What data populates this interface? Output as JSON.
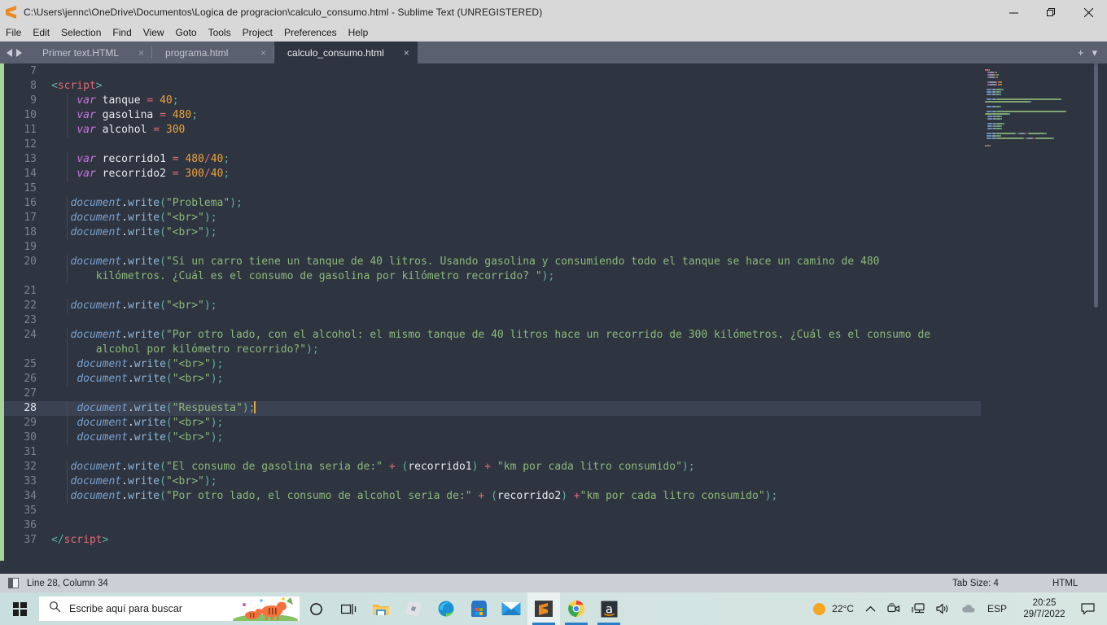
{
  "window": {
    "title": "C:\\Users\\jennc\\OneDrive\\Documentos\\Logica de progracion\\calculo_consumo.html - Sublime Text (UNREGISTERED)",
    "app_logo": "sublime-text-logo",
    "controls": {
      "minimize": "minimize-icon",
      "maximize": "restore-icon",
      "close": "close-icon"
    }
  },
  "menubar": {
    "items": [
      {
        "label": "File"
      },
      {
        "label": "Edit"
      },
      {
        "label": "Selection"
      },
      {
        "label": "Find"
      },
      {
        "label": "View"
      },
      {
        "label": "Goto"
      },
      {
        "label": "Tools"
      },
      {
        "label": "Project"
      },
      {
        "label": "Preferences"
      },
      {
        "label": "Help"
      }
    ]
  },
  "tabs": {
    "nav_prev": "prev-tab-arrow",
    "nav_next": "next-tab-arrow",
    "close_glyph": "×",
    "add_glyph": "+",
    "menu_glyph": "▾",
    "items": [
      {
        "label": "Primer text.HTML",
        "active": false
      },
      {
        "label": "programa.html",
        "active": false
      },
      {
        "label": "calculo_consumo.html",
        "active": true
      }
    ]
  },
  "editor": {
    "first_line": 7,
    "active_line": 28,
    "lines": [
      {
        "n": 7,
        "tokens": []
      },
      {
        "n": 8,
        "tokens": [
          {
            "t": "punct",
            "v": "<"
          },
          {
            "t": "tag",
            "v": "script"
          },
          {
            "t": "punct",
            "v": ">"
          }
        ]
      },
      {
        "n": 9,
        "tokens": [
          {
            "t": "plain",
            "v": "    "
          },
          {
            "t": "kw",
            "v": "var"
          },
          {
            "t": "var",
            "v": " tanque "
          },
          {
            "t": "op",
            "v": "="
          },
          {
            "t": "plain",
            "v": " "
          },
          {
            "t": "num",
            "v": "40"
          },
          {
            "t": "punct",
            "v": ";"
          }
        ]
      },
      {
        "n": 10,
        "tokens": [
          {
            "t": "plain",
            "v": "    "
          },
          {
            "t": "kw",
            "v": "var"
          },
          {
            "t": "var",
            "v": " gasolina "
          },
          {
            "t": "op",
            "v": "="
          },
          {
            "t": "plain",
            "v": " "
          },
          {
            "t": "num",
            "v": "480"
          },
          {
            "t": "punct",
            "v": ";"
          }
        ]
      },
      {
        "n": 11,
        "tokens": [
          {
            "t": "plain",
            "v": "    "
          },
          {
            "t": "kw",
            "v": "var"
          },
          {
            "t": "var",
            "v": " alcohol "
          },
          {
            "t": "op",
            "v": "="
          },
          {
            "t": "plain",
            "v": " "
          },
          {
            "t": "num",
            "v": "300"
          }
        ]
      },
      {
        "n": 12,
        "tokens": []
      },
      {
        "n": 13,
        "tokens": [
          {
            "t": "plain",
            "v": "    "
          },
          {
            "t": "kw",
            "v": "var"
          },
          {
            "t": "var",
            "v": " recorrido1 "
          },
          {
            "t": "op",
            "v": "="
          },
          {
            "t": "plain",
            "v": " "
          },
          {
            "t": "num",
            "v": "480"
          },
          {
            "t": "op",
            "v": "/"
          },
          {
            "t": "num",
            "v": "40"
          },
          {
            "t": "punct",
            "v": ";"
          }
        ]
      },
      {
        "n": 14,
        "tokens": [
          {
            "t": "plain",
            "v": "    "
          },
          {
            "t": "kw",
            "v": "var"
          },
          {
            "t": "var",
            "v": " recorrido2 "
          },
          {
            "t": "op",
            "v": "="
          },
          {
            "t": "plain",
            "v": " "
          },
          {
            "t": "num",
            "v": "300"
          },
          {
            "t": "op",
            "v": "/"
          },
          {
            "t": "num",
            "v": "40"
          },
          {
            "t": "punct",
            "v": ";"
          }
        ]
      },
      {
        "n": 15,
        "tokens": []
      },
      {
        "n": 16,
        "tokens": [
          {
            "t": "plain",
            "v": "   "
          },
          {
            "t": "obj",
            "v": "document"
          },
          {
            "t": "plain",
            "v": "."
          },
          {
            "t": "fn",
            "v": "write"
          },
          {
            "t": "paren",
            "v": "("
          },
          {
            "t": "str",
            "v": "\"Problema\""
          },
          {
            "t": "paren",
            "v": ")"
          },
          {
            "t": "punct",
            "v": ";"
          }
        ]
      },
      {
        "n": 17,
        "tokens": [
          {
            "t": "plain",
            "v": "   "
          },
          {
            "t": "obj",
            "v": "document"
          },
          {
            "t": "plain",
            "v": "."
          },
          {
            "t": "fn",
            "v": "write"
          },
          {
            "t": "paren",
            "v": "("
          },
          {
            "t": "str",
            "v": "\"<br>\""
          },
          {
            "t": "paren",
            "v": ")"
          },
          {
            "t": "punct",
            "v": ";"
          }
        ]
      },
      {
        "n": 18,
        "tokens": [
          {
            "t": "plain",
            "v": "   "
          },
          {
            "t": "obj",
            "v": "document"
          },
          {
            "t": "plain",
            "v": "."
          },
          {
            "t": "fn",
            "v": "write"
          },
          {
            "t": "paren",
            "v": "("
          },
          {
            "t": "str",
            "v": "\"<br>\""
          },
          {
            "t": "paren",
            "v": ")"
          },
          {
            "t": "punct",
            "v": ";"
          }
        ]
      },
      {
        "n": 19,
        "tokens": []
      },
      {
        "n": 20,
        "tokens": [
          {
            "t": "plain",
            "v": "   "
          },
          {
            "t": "obj",
            "v": "document"
          },
          {
            "t": "plain",
            "v": "."
          },
          {
            "t": "fn",
            "v": "write"
          },
          {
            "t": "paren",
            "v": "("
          },
          {
            "t": "str",
            "v": "\"Si un carro tiene un tanque de 40 litros. Usando gasolina y consumiendo todo el tanque se hace un camino de 480"
          }
        ]
      },
      {
        "n": "",
        "wrap": true,
        "tokens": [
          {
            "t": "str",
            "v": "       kilómetros. ¿Cuál es el consumo de gasolina por kilómetro recorrido? \""
          },
          {
            "t": "paren",
            "v": ")"
          },
          {
            "t": "punct",
            "v": ";"
          }
        ]
      },
      {
        "n": 21,
        "tokens": []
      },
      {
        "n": 22,
        "tokens": [
          {
            "t": "plain",
            "v": "   "
          },
          {
            "t": "obj",
            "v": "document"
          },
          {
            "t": "plain",
            "v": "."
          },
          {
            "t": "fn",
            "v": "write"
          },
          {
            "t": "paren",
            "v": "("
          },
          {
            "t": "str",
            "v": "\"<br>\""
          },
          {
            "t": "paren",
            "v": ")"
          },
          {
            "t": "punct",
            "v": ";"
          }
        ]
      },
      {
        "n": 23,
        "tokens": []
      },
      {
        "n": 24,
        "tokens": [
          {
            "t": "plain",
            "v": "   "
          },
          {
            "t": "obj",
            "v": "document"
          },
          {
            "t": "plain",
            "v": "."
          },
          {
            "t": "fn",
            "v": "write"
          },
          {
            "t": "paren",
            "v": "("
          },
          {
            "t": "str",
            "v": "\"Por otro lado, con el alcohol: el mismo tanque de 40 litros hace un recorrido de 300 kilómetros. ¿Cuál es el consumo de"
          }
        ]
      },
      {
        "n": "",
        "wrap": true,
        "tokens": [
          {
            "t": "str",
            "v": "       alcohol por kilómetro recorrido?\""
          },
          {
            "t": "paren",
            "v": ")"
          },
          {
            "t": "punct",
            "v": ";"
          }
        ]
      },
      {
        "n": 25,
        "tokens": [
          {
            "t": "plain",
            "v": "    "
          },
          {
            "t": "obj",
            "v": "document"
          },
          {
            "t": "plain",
            "v": "."
          },
          {
            "t": "fn",
            "v": "write"
          },
          {
            "t": "paren",
            "v": "("
          },
          {
            "t": "str",
            "v": "\"<br>\""
          },
          {
            "t": "paren",
            "v": ")"
          },
          {
            "t": "punct",
            "v": ";"
          }
        ]
      },
      {
        "n": 26,
        "tokens": [
          {
            "t": "plain",
            "v": "    "
          },
          {
            "t": "obj",
            "v": "document"
          },
          {
            "t": "plain",
            "v": "."
          },
          {
            "t": "fn",
            "v": "write"
          },
          {
            "t": "paren",
            "v": "("
          },
          {
            "t": "str",
            "v": "\"<br>\""
          },
          {
            "t": "paren",
            "v": ")"
          },
          {
            "t": "punct",
            "v": ";"
          }
        ]
      },
      {
        "n": 27,
        "tokens": []
      },
      {
        "n": 28,
        "active": true,
        "cursor": true,
        "tokens": [
          {
            "t": "plain",
            "v": "    "
          },
          {
            "t": "obj",
            "v": "document"
          },
          {
            "t": "plain",
            "v": "."
          },
          {
            "t": "fn",
            "v": "write"
          },
          {
            "t": "paren",
            "v": "("
          },
          {
            "t": "str",
            "v": "\"Respuesta\""
          },
          {
            "t": "paren",
            "v": ")"
          },
          {
            "t": "punct",
            "v": ";"
          }
        ]
      },
      {
        "n": 29,
        "tokens": [
          {
            "t": "plain",
            "v": "    "
          },
          {
            "t": "obj",
            "v": "document"
          },
          {
            "t": "plain",
            "v": "."
          },
          {
            "t": "fn",
            "v": "write"
          },
          {
            "t": "paren",
            "v": "("
          },
          {
            "t": "str",
            "v": "\"<br>\""
          },
          {
            "t": "paren",
            "v": ")"
          },
          {
            "t": "punct",
            "v": ";"
          }
        ]
      },
      {
        "n": 30,
        "tokens": [
          {
            "t": "plain",
            "v": "    "
          },
          {
            "t": "obj",
            "v": "document"
          },
          {
            "t": "plain",
            "v": "."
          },
          {
            "t": "fn",
            "v": "write"
          },
          {
            "t": "paren",
            "v": "("
          },
          {
            "t": "str",
            "v": "\"<br>\""
          },
          {
            "t": "paren",
            "v": ")"
          },
          {
            "t": "punct",
            "v": ";"
          }
        ]
      },
      {
        "n": 31,
        "tokens": []
      },
      {
        "n": 32,
        "tokens": [
          {
            "t": "plain",
            "v": "   "
          },
          {
            "t": "obj",
            "v": "document"
          },
          {
            "t": "plain",
            "v": "."
          },
          {
            "t": "fn",
            "v": "write"
          },
          {
            "t": "paren",
            "v": "("
          },
          {
            "t": "str",
            "v": "\"El consumo de gasolina seria de:\""
          },
          {
            "t": "plain",
            "v": " "
          },
          {
            "t": "op",
            "v": "+"
          },
          {
            "t": "plain",
            "v": " "
          },
          {
            "t": "paren",
            "v": "("
          },
          {
            "t": "var",
            "v": "recorrido1"
          },
          {
            "t": "paren",
            "v": ")"
          },
          {
            "t": "plain",
            "v": " "
          },
          {
            "t": "op",
            "v": "+"
          },
          {
            "t": "plain",
            "v": " "
          },
          {
            "t": "str",
            "v": "\"km por cada litro consumido\""
          },
          {
            "t": "paren",
            "v": ")"
          },
          {
            "t": "punct",
            "v": ";"
          }
        ]
      },
      {
        "n": 33,
        "tokens": [
          {
            "t": "plain",
            "v": "   "
          },
          {
            "t": "obj",
            "v": "document"
          },
          {
            "t": "plain",
            "v": "."
          },
          {
            "t": "fn",
            "v": "write"
          },
          {
            "t": "paren",
            "v": "("
          },
          {
            "t": "str",
            "v": "\"<br>\""
          },
          {
            "t": "paren",
            "v": ")"
          },
          {
            "t": "punct",
            "v": ";"
          }
        ]
      },
      {
        "n": 34,
        "tokens": [
          {
            "t": "plain",
            "v": "   "
          },
          {
            "t": "obj",
            "v": "document"
          },
          {
            "t": "plain",
            "v": "."
          },
          {
            "t": "fn",
            "v": "write"
          },
          {
            "t": "paren",
            "v": "("
          },
          {
            "t": "str",
            "v": "\"Por otro lado, el consumo de alcohol seria de:\""
          },
          {
            "t": "plain",
            "v": " "
          },
          {
            "t": "op",
            "v": "+"
          },
          {
            "t": "plain",
            "v": " "
          },
          {
            "t": "paren",
            "v": "("
          },
          {
            "t": "var",
            "v": "recorrido2"
          },
          {
            "t": "paren",
            "v": ")"
          },
          {
            "t": "plain",
            "v": " "
          },
          {
            "t": "op",
            "v": "+"
          },
          {
            "t": "str",
            "v": "\"km por cada litro consumido\""
          },
          {
            "t": "paren",
            "v": ")"
          },
          {
            "t": "punct",
            "v": ";"
          }
        ]
      },
      {
        "n": 35,
        "tokens": []
      },
      {
        "n": 36,
        "tokens": []
      },
      {
        "n": 37,
        "tokens": [
          {
            "t": "punct",
            "v": "<"
          },
          {
            "t": "punct",
            "v": "/"
          },
          {
            "t": "tag",
            "v": "script"
          },
          {
            "t": "punct",
            "v": ">"
          }
        ]
      }
    ]
  },
  "statusbar": {
    "sidebar_toggle": "sidebar-toggle-icon",
    "position": "Line 28, Column 34",
    "tab_size": "Tab Size: 4",
    "syntax": "HTML"
  },
  "taskbar": {
    "start": "windows-start-icon",
    "search": {
      "placeholder": "Escribe aquí para buscar",
      "icon": "search-icon"
    },
    "cortana": "cortana-circle-icon",
    "taskview": "task-view-icon",
    "apps": [
      {
        "name": "file-explorer-icon",
        "running": false
      },
      {
        "name": "roblox-icon",
        "running": false
      },
      {
        "name": "microsoft-edge-icon",
        "running": false
      },
      {
        "name": "microsoft-store-icon",
        "running": false
      },
      {
        "name": "mail-icon",
        "running": false
      },
      {
        "name": "sublime-text-icon",
        "running": true
      },
      {
        "name": "google-chrome-icon",
        "running": true
      },
      {
        "name": "amazon-icon",
        "running": true
      }
    ],
    "tray": {
      "weather_icon": "sun-icon",
      "weather": "22°C",
      "chevron": "show-hidden-icons-chevron",
      "camera": "camera-icon",
      "network": "network-icon",
      "volume": "volume-icon",
      "onedrive": "onedrive-cloud-icon",
      "language": "ESP",
      "time": "20:25",
      "date": "29/7/2022",
      "notifications": "notification-center-icon"
    }
  },
  "colors": {
    "titlebar_bg": "#d8d8d8",
    "tabbar_bg": "#5a6070",
    "editor_bg": "#2e3440",
    "active_line_bg": "#3b4252",
    "accent_orange": "#e8a33d",
    "string_green": "#8cba7a",
    "tag_red": "#e06c75",
    "keyword_purple": "#c678dd",
    "left_strip_green": "#a6d39a",
    "statusbar_bg": "#ccd0d6",
    "taskbar_bg": "#cfe0e0"
  }
}
